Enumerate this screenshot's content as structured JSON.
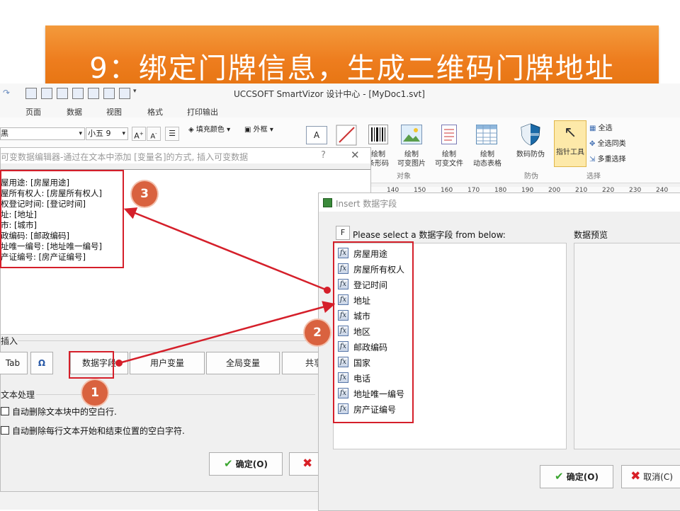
{
  "banner": {
    "title": "9：绑定门牌信息，生成二维码门牌地址"
  },
  "app": {
    "title": "UCCSOFT SmartVizor 设计中心 - [MyDoc1.svt]",
    "menu": [
      "页面",
      "数据",
      "视图",
      "格式",
      "打印输出"
    ],
    "ribbon": {
      "font_name": "黑",
      "font_size": "小五 9",
      "fill_color": "填充颜色",
      "border": "外框",
      "draw_barcode": "绘制\n条形码",
      "draw_variable_image": "绘制\n可变图片",
      "draw_variable_file": "绘制\n可变文件",
      "draw_dynamic_table": "绘制\n动态表格",
      "anti_counterfeit": "数码防伪",
      "pointer_tool": "指针工具",
      "select_all": "全选",
      "select_same": "全选同类",
      "multi_select": "多重选择",
      "group_object": "对象",
      "group_security": "防伪",
      "group_select": "选择"
    },
    "ruler_ticks": [
      "140",
      "150",
      "160",
      "170",
      "180",
      "190",
      "200",
      "210",
      "220",
      "230",
      "240"
    ]
  },
  "dialog_editor": {
    "title": "可变数据编辑器-通过在文本中添加 [变量名]的方式, 插入可变数据",
    "help": "?",
    "close": "✕",
    "lines": [
      "屋用途: [房屋用途]",
      "屋所有权人: [房屋所有权人]",
      "权登记时间: [登记时间]",
      "址: [地址]",
      "市: [城市]",
      "政编码: [邮政编码]",
      "址唯一编号: [地址唯一编号]",
      "产证编号: [房产证编号]"
    ],
    "insert_section": "插入",
    "buttons": {
      "tab": "Tab",
      "omega": "Ω",
      "data_field": "数据字段",
      "user_variable": "用户变量",
      "global_variable": "全局变量",
      "shared": "共享"
    },
    "text_section": "文本处理",
    "options": [
      "自动删除文本块中的空白行.",
      "自动删除每行文本开始和结束位置的空白字符."
    ],
    "ok": "确定(O)"
  },
  "dialog_insert": {
    "title": "Insert 数据字段",
    "filter_button": "F",
    "prompt": "Please select a 数据字段 from below:",
    "preview_label": "数据预览",
    "fields": [
      "房屋用途",
      "房屋所有权人",
      "登记时间",
      "地址",
      "城市",
      "地区",
      "邮政编码",
      "国家",
      "电话",
      "地址唯一编号",
      "房产证编号"
    ],
    "ok": "确定(O)",
    "cancel": "取消(C)"
  },
  "annotations": {
    "badges": [
      "1",
      "2",
      "3"
    ],
    "accent": "#d51f2a",
    "badge_color": "#d9623f"
  }
}
